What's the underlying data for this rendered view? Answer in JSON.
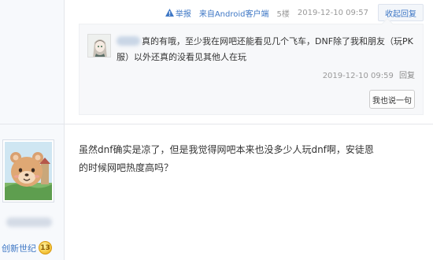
{
  "post_tail": {
    "report_label": "举报",
    "client_text": "来自Android客户端",
    "floor": "5楼",
    "datetime": "2019-12-10 09:57",
    "collapse_label": "收起回复"
  },
  "replies": [
    {
      "text": "真的有哦，至少我在网吧还能看见几个飞车，DNF除了我和朋友（玩PK服）以外还真的没看见其他人在玩",
      "time": "2019-12-10 09:59",
      "reply_label": "回复"
    }
  ],
  "say_button": "我也说一句",
  "second_floor": {
    "content": "虽然dnf确实是凉了，但是我觉得网吧本来也没多少人玩dnf啊，安徒恩的时候网吧热度高吗？",
    "level_name": "创新世纪",
    "level": "13"
  },
  "colors": {
    "link": "#3e77c5",
    "meta": "#999999",
    "reply_bg": "#f7f8fa"
  },
  "icons": [
    "warning-icon",
    "level-badge-icon"
  ]
}
